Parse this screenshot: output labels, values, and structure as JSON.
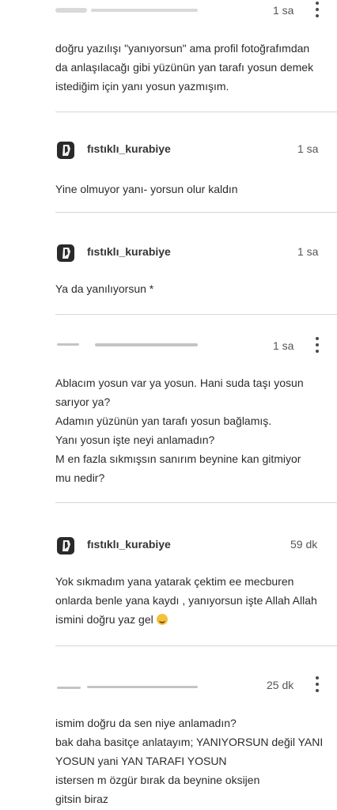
{
  "comments": [
    {
      "username": "",
      "time": "1 sa",
      "has_more": true,
      "lines": [
        "doğru yazılışı \"yanıyorsun\" ama profil fotoğrafımdan",
        "da anlaşılacağı gibi yüzünün yan tarafı yosun demek",
        "istediğim için yanı yosun yazmışım."
      ]
    },
    {
      "username": "fıstıklı_kurabiye",
      "time": "1 sa",
      "lines": [
        "Yine olmuyor yanı- yorsun olur kaldın"
      ]
    },
    {
      "username": "fıstıklı_kurabiye",
      "time": "1 sa",
      "lines": [
        "Ya da yanılıyorsun *"
      ]
    },
    {
      "username": "",
      "time": "1 sa",
      "has_more": true,
      "lines": [
        "Ablacım yosun var ya yosun. Hani suda taşı yosun",
        "sarıyor ya?",
        "Adamın yüzünün yan tarafı yosun bağlamış.",
        "Yanı yosun işte neyi anlamadın?",
        "M   en fazla sıkmışsın sanırım beynine kan gitmiyor",
        "mu nedir?"
      ]
    },
    {
      "username": "fıstıklı_kurabiye",
      "time": "59 dk",
      "lines": [
        "Yok sıkmadım yana yatarak çektim ee mecburen",
        "onlarda benle yana kaydı , yanıyorsun işte Allah Allah",
        "ismini doğru yaz gel"
      ]
    },
    {
      "username": "",
      "time": "25 dk",
      "has_more": true,
      "lines": [
        "ismim doğru da sen niye anlamadın?",
        "bak daha basitçe anlatayım; YANIYORSUN değil YANI",
        "YOSUN yani YAN TARAFI YOSUN",
        "istersen m          özgür bırak da beynine oksijen",
        "gitsin biraz"
      ]
    }
  ],
  "icons": {
    "more": "more-vertical-icon",
    "avatar": "profile-avatar",
    "emoji": "grinning-sweat-emoji"
  },
  "colors": {
    "text": "#2b2b2b",
    "separator": "#d6d6d6",
    "avatar_ring": "#d2203c"
  }
}
